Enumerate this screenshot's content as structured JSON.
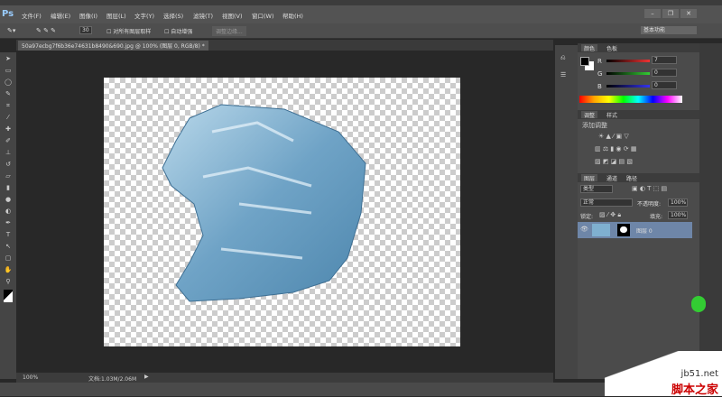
{
  "app": {
    "logo": "Ps",
    "window_buttons": [
      "–",
      "❐",
      "✕"
    ],
    "workspace": "基本功能"
  },
  "menu": [
    "文件(F)",
    "编辑(E)",
    "图像(I)",
    "图层(L)",
    "文字(Y)",
    "选择(S)",
    "滤镜(T)",
    "视图(V)",
    "窗口(W)",
    "帮助(H)"
  ],
  "options": {
    "brush_size": "30",
    "sample_all": "对所有图层取样",
    "auto_enhance": "自动增强",
    "refine_edge": "调整边缘..."
  },
  "document": {
    "tab": "50a97ecbg7f6b36e74631b8490&690.jpg @ 100% (图层 0, RGB/8) *",
    "zoom": "100%",
    "doc_size": "文档:1.03M/2.06M"
  },
  "color_panel": {
    "tabs": [
      "颜色",
      "色板"
    ],
    "r_label": "R",
    "g_label": "G",
    "b_label": "B",
    "r": "7",
    "g": "0",
    "b": "0"
  },
  "adjust_panel": {
    "tabs": [
      "调整",
      "样式"
    ],
    "title": "添加调整"
  },
  "layers_panel": {
    "tabs": [
      "图层",
      "通道",
      "路径"
    ],
    "filter": "类型",
    "blend": "正常",
    "opacity_label": "不透明度:",
    "opacity": "100%",
    "lock_label": "锁定:",
    "fill_label": "填充:",
    "fill": "100%",
    "layer_name": "图层 0"
  },
  "watermark": {
    "url": "jb51.net",
    "name": "脚本之家"
  },
  "colors": {
    "selection": "#6e86a8",
    "ice": "#7fb0d0"
  }
}
